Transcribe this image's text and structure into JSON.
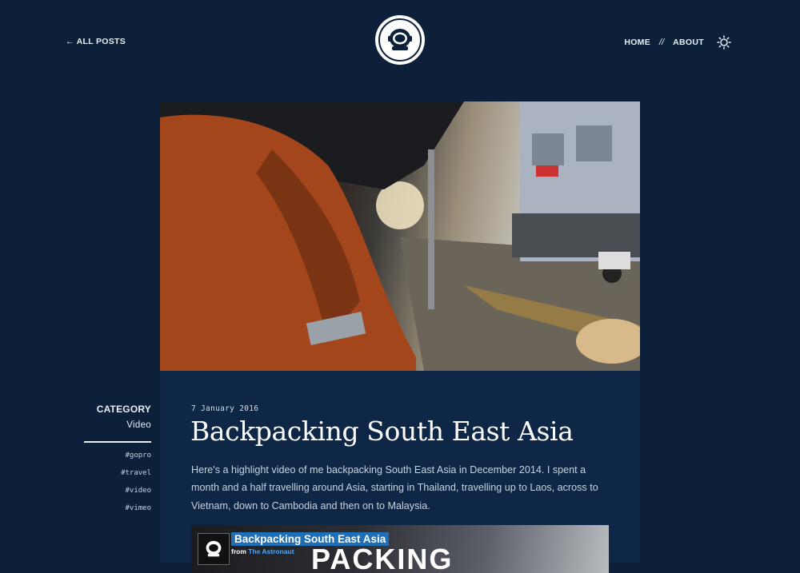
{
  "header": {
    "back_label": "← ALL POSTS",
    "nav": {
      "home": "HOME",
      "separator": "//",
      "about": "ABOUT"
    }
  },
  "post": {
    "date": "7 January 2016",
    "title": "Backpacking South East Asia",
    "body": "Here's a highlight video of me backpacking South East Asia in December 2014. I spent a month and a half travelling around Asia, starting in Thailand, travelling up to Laos, across to Vietnam, down to Cambodia and then on to Malaysia.",
    "video": {
      "title": "Backpacking South East Asia",
      "from_prefix": "from",
      "from_author": "The Astronaut",
      "big_text": "PACKING"
    }
  },
  "sidebar": {
    "category_label": "CATEGORY",
    "category_value": "Video",
    "tags": [
      "#gopro",
      "#travel",
      "#video",
      "#vimeo"
    ]
  },
  "icons": {
    "logo": "astronaut-helmet-icon",
    "theme_toggle": "sun-icon"
  },
  "colors": {
    "background": "#0c2039",
    "content_panel": "#0f2747",
    "text": "#e9eef4",
    "video_title_bg": "#1e6fb5"
  }
}
